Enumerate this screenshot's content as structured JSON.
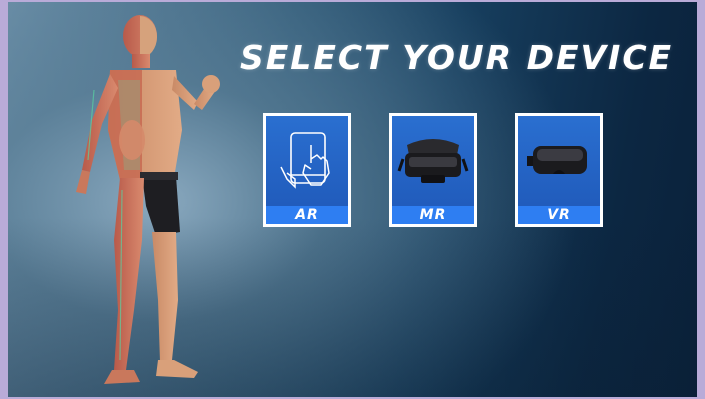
{
  "title": "SELECT YOUR DEVICE",
  "devices": [
    {
      "label": "AR",
      "icon": "tablet-touch-icon"
    },
    {
      "label": "MR",
      "icon": "mr-headset-icon"
    },
    {
      "label": "VR",
      "icon": "vr-headset-icon"
    }
  ],
  "colors": {
    "tile_blue": "#2a6fd0",
    "label_bar": "#2e7ef2",
    "frame": "#b9abd8",
    "text": "#ffffff"
  }
}
